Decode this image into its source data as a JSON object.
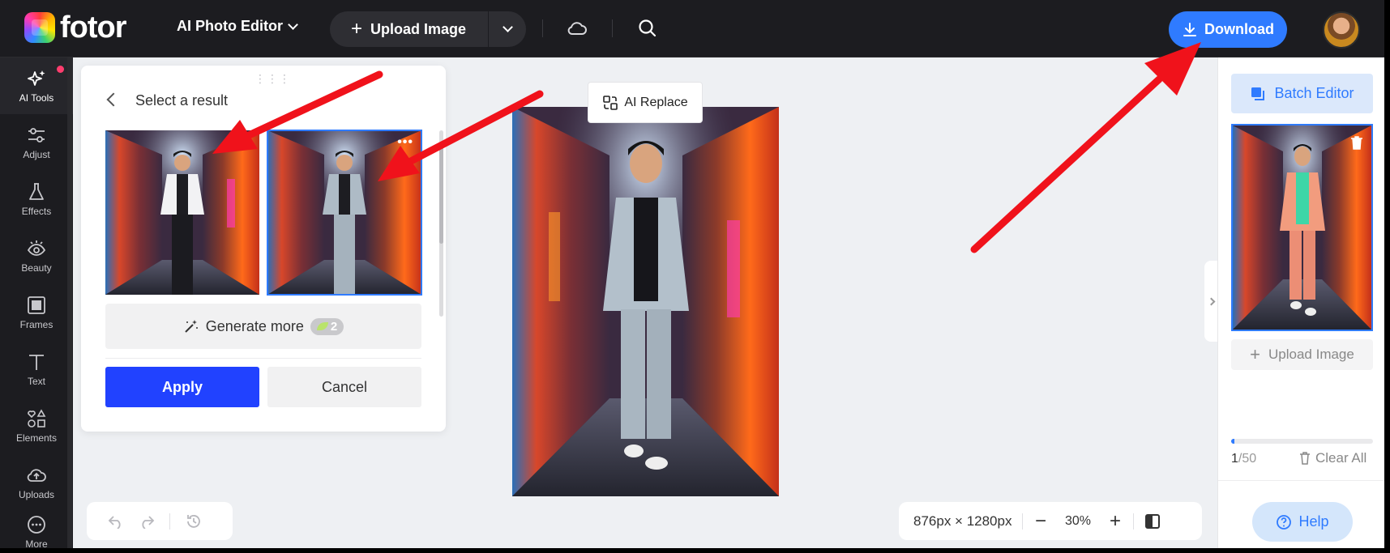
{
  "brand": {
    "name": "fotor"
  },
  "header": {
    "editor_menu": "AI Photo Editor",
    "upload_label": "Upload Image",
    "download_label": "Download",
    "accent": "#2f7bff"
  },
  "left_tools": [
    {
      "label": "AI Tools",
      "icon": "sparkle-icon"
    },
    {
      "label": "Adjust",
      "icon": "sliders-icon"
    },
    {
      "label": "Effects",
      "icon": "flask-icon"
    },
    {
      "label": "Beauty",
      "icon": "eye-icon"
    },
    {
      "label": "Frames",
      "icon": "frame-icon"
    },
    {
      "label": "Text",
      "icon": "text-icon"
    },
    {
      "label": "Elements",
      "icon": "shapes-icon"
    },
    {
      "label": "Uploads",
      "icon": "cloud-upload-icon"
    },
    {
      "label": "More",
      "icon": "more-icon"
    }
  ],
  "result_panel": {
    "title": "Select a result",
    "generate_more": "Generate more",
    "credits": "2",
    "apply": "Apply",
    "cancel": "Cancel"
  },
  "canvas": {
    "ai_replace": "AI Replace",
    "image_size": "876px × 1280px",
    "zoom": "30%"
  },
  "right_panel": {
    "batch_editor": "Batch Editor",
    "upload_image": "Upload Image",
    "count_current": "1",
    "count_total": "/50",
    "progress": 0.02,
    "clear_all": "Clear All",
    "help": "Help"
  }
}
